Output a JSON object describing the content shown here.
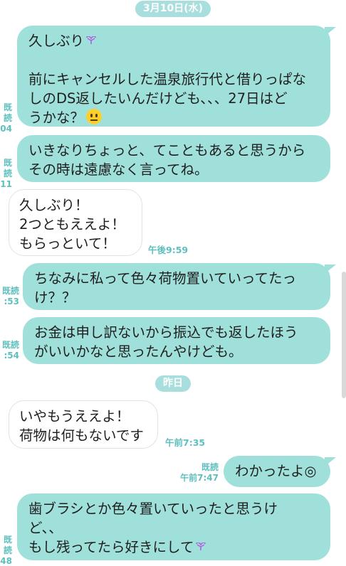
{
  "dates": {
    "first": "3月10日(水)",
    "second": "昨日"
  },
  "messages": [
    {
      "id": "m1",
      "dir": "out",
      "lines": [
        "久しぶり",
        "",
        "前にキャンセルした温泉旅行代と借りっぱな",
        "しのDS返したいんだけども、、、27日はど",
        "うかな？"
      ],
      "read": "既読",
      "time": "04"
    },
    {
      "id": "m2",
      "dir": "out",
      "lines": [
        "いきなりちょっと、てこともあると思うから",
        "その時は遠慮なく言ってね。"
      ],
      "read": "既読",
      "time": "11"
    },
    {
      "id": "m3",
      "dir": "in",
      "lines": [
        "久しぶり！",
        "2つともええよ！",
        "もらっといて！"
      ],
      "time": "午後9:59"
    },
    {
      "id": "m4",
      "dir": "out",
      "lines": [
        "ちなみに私って色々荷物置いていってたっ",
        "け？？"
      ],
      "read": "既読",
      "time": ":53"
    },
    {
      "id": "m5",
      "dir": "out",
      "lines": [
        "お金は申し訳ないから振込でも返したほう",
        "がいいかなと思ったんやけども。"
      ],
      "read": "既読",
      "time": ":54"
    },
    {
      "id": "m6",
      "dir": "in",
      "lines": [
        "いやもうええよ！",
        "荷物は何もないです"
      ],
      "time": "午前7:35"
    },
    {
      "id": "m7",
      "dir": "out",
      "lines": [
        "わかったよ◎"
      ],
      "read": "既読",
      "time": "午前7:47"
    },
    {
      "id": "m8",
      "dir": "out",
      "lines": [
        "歯ブラシとか色々置いていったと思うけ",
        "ど、、",
        "もし残ってたら好きにして"
      ],
      "read": "既読",
      "time": "48"
    }
  ],
  "icons": {
    "heart": "purple-heart-icon",
    "face": "neutral-face-icon"
  },
  "colors": {
    "out_bubble": "#a0e0da",
    "in_bubble": "#ffffff",
    "meta": "#5fbfbf",
    "pill": "#a8dede",
    "heart": "#b061e0"
  }
}
